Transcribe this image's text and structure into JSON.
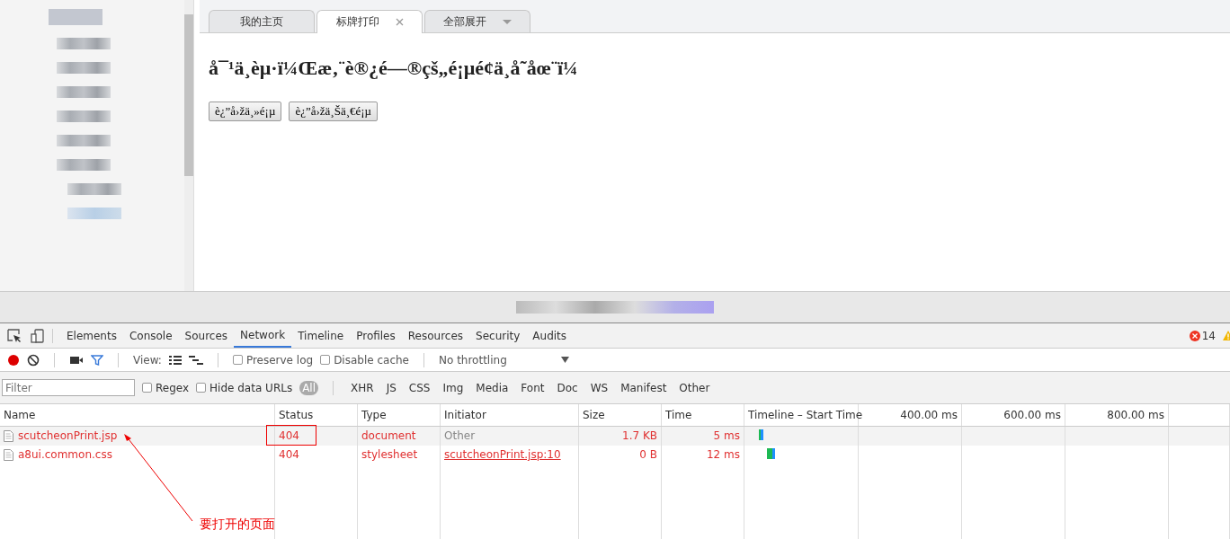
{
  "sidebar": {
    "items": [
      {
        "kind": "header"
      },
      {
        "kind": "item"
      },
      {
        "kind": "item"
      },
      {
        "kind": "item"
      },
      {
        "kind": "item"
      },
      {
        "kind": "item"
      },
      {
        "kind": "item"
      },
      {
        "kind": "child"
      },
      {
        "kind": "child"
      }
    ]
  },
  "tabs": [
    {
      "label": "我的主页",
      "selected": false,
      "closable": false,
      "dropdown": false
    },
    {
      "label": "标牌打印",
      "selected": true,
      "closable": true,
      "dropdown": false
    },
    {
      "label": "全部展开",
      "selected": false,
      "closable": false,
      "dropdown": true
    }
  ],
  "page": {
    "heading": "å¯¹ä¸èµ·ï¼Œæ‚¨è®¿é—®çš„é¡µé¢ä¸å˜åœ¨ï¼",
    "buttons": [
      "è¿”å›žä¸»é¡µ",
      "è¿”å›žä¸Šä¸€é¡µ"
    ]
  },
  "devtools": {
    "panels": [
      {
        "label": "Elements",
        "selected": false
      },
      {
        "label": "Console",
        "selected": false
      },
      {
        "label": "Sources",
        "selected": false
      },
      {
        "label": "Network",
        "selected": true
      },
      {
        "label": "Timeline",
        "selected": false
      },
      {
        "label": "Profiles",
        "selected": false
      },
      {
        "label": "Resources",
        "selected": false
      },
      {
        "label": "Security",
        "selected": false
      },
      {
        "label": "Audits",
        "selected": false
      }
    ],
    "error_count": "14",
    "toolbar": {
      "recording": true,
      "view_label": "View:",
      "preserve_log": {
        "label": "Preserve log",
        "checked": false
      },
      "disable_cache": {
        "label": "Disable cache",
        "checked": false
      },
      "throttling": "No throttling"
    },
    "filter": {
      "placeholder": "Filter",
      "regex": {
        "label": "Regex",
        "checked": false
      },
      "hide_data_urls": {
        "label": "Hide data URLs",
        "checked": false
      },
      "types": [
        {
          "label": "All",
          "selected": true
        },
        {
          "label": "XHR",
          "selected": false
        },
        {
          "label": "JS",
          "selected": false
        },
        {
          "label": "CSS",
          "selected": false
        },
        {
          "label": "Img",
          "selected": false
        },
        {
          "label": "Media",
          "selected": false
        },
        {
          "label": "Font",
          "selected": false
        },
        {
          "label": "Doc",
          "selected": false
        },
        {
          "label": "WS",
          "selected": false
        },
        {
          "label": "Manifest",
          "selected": false
        },
        {
          "label": "Other",
          "selected": false
        }
      ]
    },
    "table": {
      "columns": [
        "Name",
        "Status",
        "Type",
        "Initiator",
        "Size",
        "Time",
        "Timeline – Start Time"
      ],
      "ticks": [
        "400.00 ms",
        "600.00 ms",
        "800.00 ms"
      ],
      "rows": [
        {
          "name": "scutcheonPrint.jsp",
          "status": "404",
          "type": "document",
          "initiator": "Other",
          "initiator_link": false,
          "size": "1.7 KB",
          "time": "5 ms",
          "selected": true
        },
        {
          "name": "a8ui.common.css",
          "status": "404",
          "type": "stylesheet",
          "initiator": "scutcheonPrint.jsp:10",
          "initiator_link": true,
          "size": "0 B",
          "time": "12 ms",
          "selected": false
        }
      ]
    }
  },
  "annotation": {
    "text": "要打开的页面"
  }
}
